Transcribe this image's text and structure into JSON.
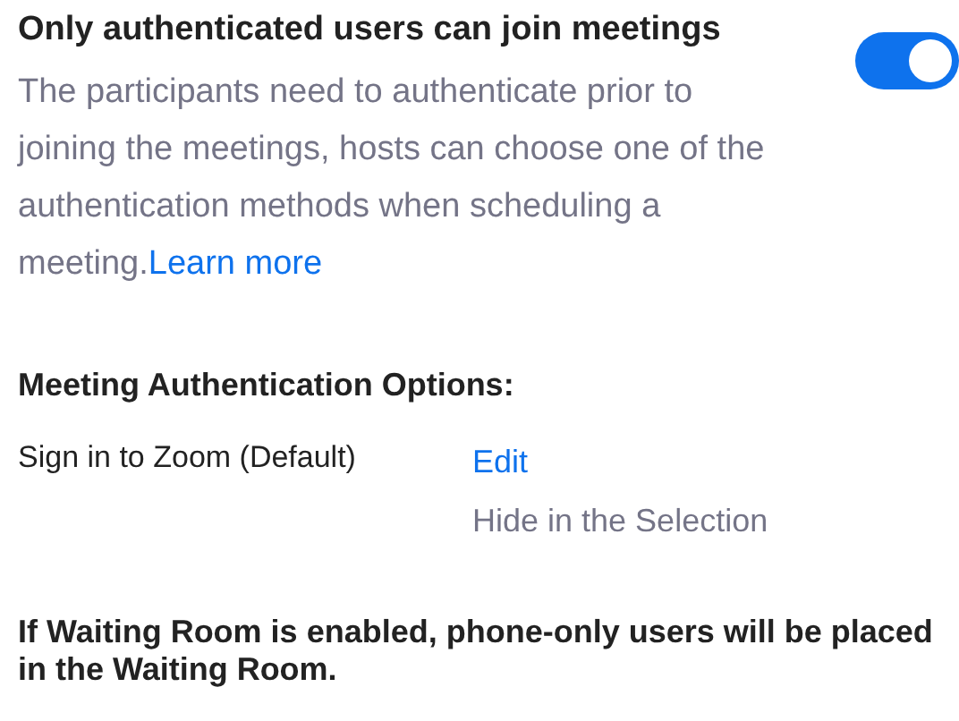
{
  "setting": {
    "title": "Only authenticated users can join meetings",
    "on": true,
    "description": "The participants need to authenticate prior to joining the meetings, hosts can choose one of the authentication methods when scheduling a meeting.",
    "link": "Learn more"
  },
  "options": {
    "heading": "Meeting Authentication Options:",
    "items": [
      {
        "name": "Sign in to Zoom (Default)",
        "action": "Edit",
        "note": "Hide in the Selection"
      }
    ]
  },
  "footer": "If Waiting Room is enabled, phone-only users will be placed in the Waiting Room."
}
